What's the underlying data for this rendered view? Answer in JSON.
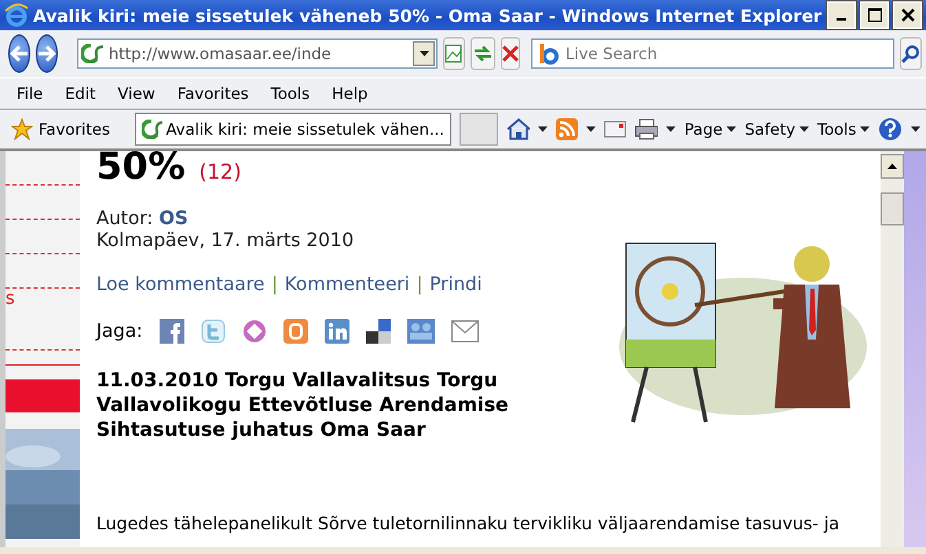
{
  "window": {
    "title": "Avalik kiri: meie sissetulek väheneb 50% - Oma Saar - Windows Internet Explorer"
  },
  "address": {
    "value": "http://www.omasaar.ee/inde"
  },
  "search": {
    "placeholder": "Live Search"
  },
  "menu": [
    "File",
    "Edit",
    "View",
    "Favorites",
    "Tools",
    "Help"
  ],
  "favorites_bar": {
    "favorites": "Favorites",
    "tabs": [
      {
        "label": "Avalik kiri: meie sissetulek vähen...",
        "selected": true
      }
    ],
    "commands": [
      "Page",
      "Safety",
      "Tools"
    ]
  },
  "sidebar": {
    "marker": "s"
  },
  "article": {
    "heading": "50%",
    "comment_count": "(12)",
    "author_label": "Autor:",
    "author": "OS",
    "date": "Kolmapäev, 17. märts 2010",
    "links": [
      "Loe kommentaare",
      "Kommenteeri",
      "Prindi"
    ],
    "separator": "|",
    "share_label": "Jaga:",
    "subtitle": "11.03.2010 Torgu Vallavalitsus Torgu Vallavolikogu Ettevõtluse Arendamise Sihtasutuse juhatus Oma Saar",
    "body": "Lugedes tähelepanelikult Sõrve tuletornilinnaku tervikliku väljaarendamise tasuvus- ja"
  }
}
